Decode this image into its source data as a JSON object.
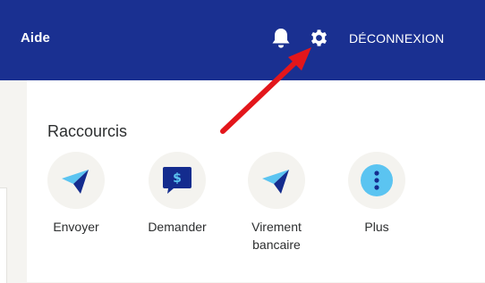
{
  "header": {
    "help_label": "Aide",
    "logout_label": "DÉCONNEXION",
    "bell_icon": "bell-icon",
    "settings_icon": "gear-icon"
  },
  "shortcuts": {
    "title": "Raccourcis",
    "items": [
      {
        "label": "Envoyer",
        "icon": "send-arrow-icon"
      },
      {
        "label": "Demander",
        "icon": "request-money-icon"
      },
      {
        "label": "Virement\nbancaire",
        "icon": "send-arrow-icon"
      },
      {
        "label": "Plus",
        "icon": "more-dots-icon"
      }
    ]
  },
  "colors": {
    "header_bg": "#1a3091",
    "accent_blue": "#0070e0",
    "light_blue": "#5bc4f1",
    "dark_navy": "#142c8e",
    "annotation_red": "#e3161b"
  }
}
